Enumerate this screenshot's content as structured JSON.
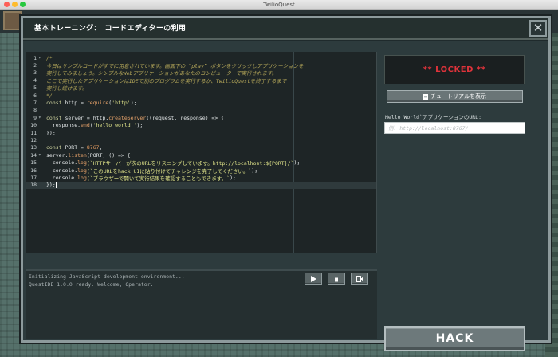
{
  "window": {
    "title": "TwilioQuest"
  },
  "modal": {
    "title": "基本トレーニング：　コードエディターの利用",
    "close_label": "✕"
  },
  "editor": {
    "lines": [
      {
        "n": "1",
        "fold": "▾",
        "segments": [
          {
            "c": "cm",
            "t": "/*"
          }
        ]
      },
      {
        "n": "2",
        "fold": "",
        "segments": [
          {
            "c": "cm",
            "t": "今日はサンプルコードがすでに用意されています。画面下の “play” ボタンをクリックしアプリケーションを"
          }
        ]
      },
      {
        "n": "3",
        "fold": "",
        "segments": [
          {
            "c": "cm",
            "t": "実行してみましょう。シンプルなWebアプリケーションがあなたのコンピューターで実行されます。"
          }
        ]
      },
      {
        "n": "4",
        "fold": "",
        "segments": [
          {
            "c": "cm",
            "t": "ここで実行したアプリケーションはIDEで別のプログラムを実行するか、TwilioQuestを終了するまで"
          }
        ]
      },
      {
        "n": "5",
        "fold": "",
        "segments": [
          {
            "c": "cm",
            "t": "実行し続けます。"
          }
        ]
      },
      {
        "n": "6",
        "fold": "",
        "segments": [
          {
            "c": "cm",
            "t": "*/"
          }
        ]
      },
      {
        "n": "7",
        "fold": "",
        "segments": [
          {
            "c": "kw",
            "t": "const "
          },
          {
            "c": "code",
            "t": "http = "
          },
          {
            "c": "fn",
            "t": "require"
          },
          {
            "c": "code",
            "t": "("
          },
          {
            "c": "st",
            "t": "'http'"
          },
          {
            "c": "code",
            "t": ");"
          }
        ]
      },
      {
        "n": "8",
        "fold": "",
        "segments": []
      },
      {
        "n": "9",
        "fold": "▾",
        "segments": [
          {
            "c": "kw",
            "t": "const "
          },
          {
            "c": "code",
            "t": "server = http."
          },
          {
            "c": "fn",
            "t": "createServer"
          },
          {
            "c": "code",
            "t": "((request, response) => {"
          }
        ]
      },
      {
        "n": "10",
        "fold": "",
        "segments": [
          {
            "c": "code",
            "t": "  response."
          },
          {
            "c": "fn",
            "t": "end"
          },
          {
            "c": "code",
            "t": "("
          },
          {
            "c": "st",
            "t": "'hello world!'"
          },
          {
            "c": "code",
            "t": ");"
          }
        ]
      },
      {
        "n": "11",
        "fold": "",
        "segments": [
          {
            "c": "code",
            "t": "});"
          }
        ]
      },
      {
        "n": "12",
        "fold": "",
        "segments": []
      },
      {
        "n": "13",
        "fold": "",
        "segments": [
          {
            "c": "kw",
            "t": "const "
          },
          {
            "c": "code",
            "t": "PORT = "
          },
          {
            "c": "nm",
            "t": "8767"
          },
          {
            "c": "code",
            "t": ";"
          }
        ]
      },
      {
        "n": "14",
        "fold": "▾",
        "segments": [
          {
            "c": "code",
            "t": "server."
          },
          {
            "c": "fn",
            "t": "listen"
          },
          {
            "c": "code",
            "t": "(PORT, () => {"
          }
        ]
      },
      {
        "n": "15",
        "fold": "",
        "segments": [
          {
            "c": "code",
            "t": "  console."
          },
          {
            "c": "fn",
            "t": "log"
          },
          {
            "c": "st",
            "t": "(`HTTPサーバーが次のURLをリスニングしています。http://localhost:${PORT}/`"
          },
          {
            "c": "code",
            "t": ");"
          }
        ]
      },
      {
        "n": "16",
        "fold": "",
        "segments": [
          {
            "c": "code",
            "t": "  console."
          },
          {
            "c": "fn",
            "t": "log"
          },
          {
            "c": "st",
            "t": "(`このURLをhack UIに貼り付けてチャレンジを完了してください。`"
          },
          {
            "c": "code",
            "t": ");"
          }
        ]
      },
      {
        "n": "17",
        "fold": "",
        "segments": [
          {
            "c": "code",
            "t": "  console."
          },
          {
            "c": "fn",
            "t": "log"
          },
          {
            "c": "st",
            "t": "(`ブラウザーで開いて実行結果を確認することもできます。`"
          },
          {
            "c": "code",
            "t": ");"
          }
        ]
      },
      {
        "n": "18",
        "fold": "",
        "segments": [
          {
            "c": "code",
            "t": "});"
          }
        ],
        "active": true
      }
    ]
  },
  "console": {
    "lines": [
      "Initializing JavaScript development environment...",
      "QuestIDE 1.0.0 ready. Welcome, Operator."
    ]
  },
  "controls": {
    "play_icon": "play-icon",
    "stop_icon": "stop-icon",
    "exit_icon": "exit-icon"
  },
  "panel": {
    "locked_text": "** LOCKED **",
    "tutorial_label": "チュートリアルを表示",
    "url_label": "Hello World`アプリケーションのURL:",
    "url_placeholder": "例. http://localhost:8767/",
    "url_value": "",
    "hack_label": "HACK"
  },
  "colors": {
    "locked": "#e0333b",
    "accent": "#8d9a9c"
  }
}
